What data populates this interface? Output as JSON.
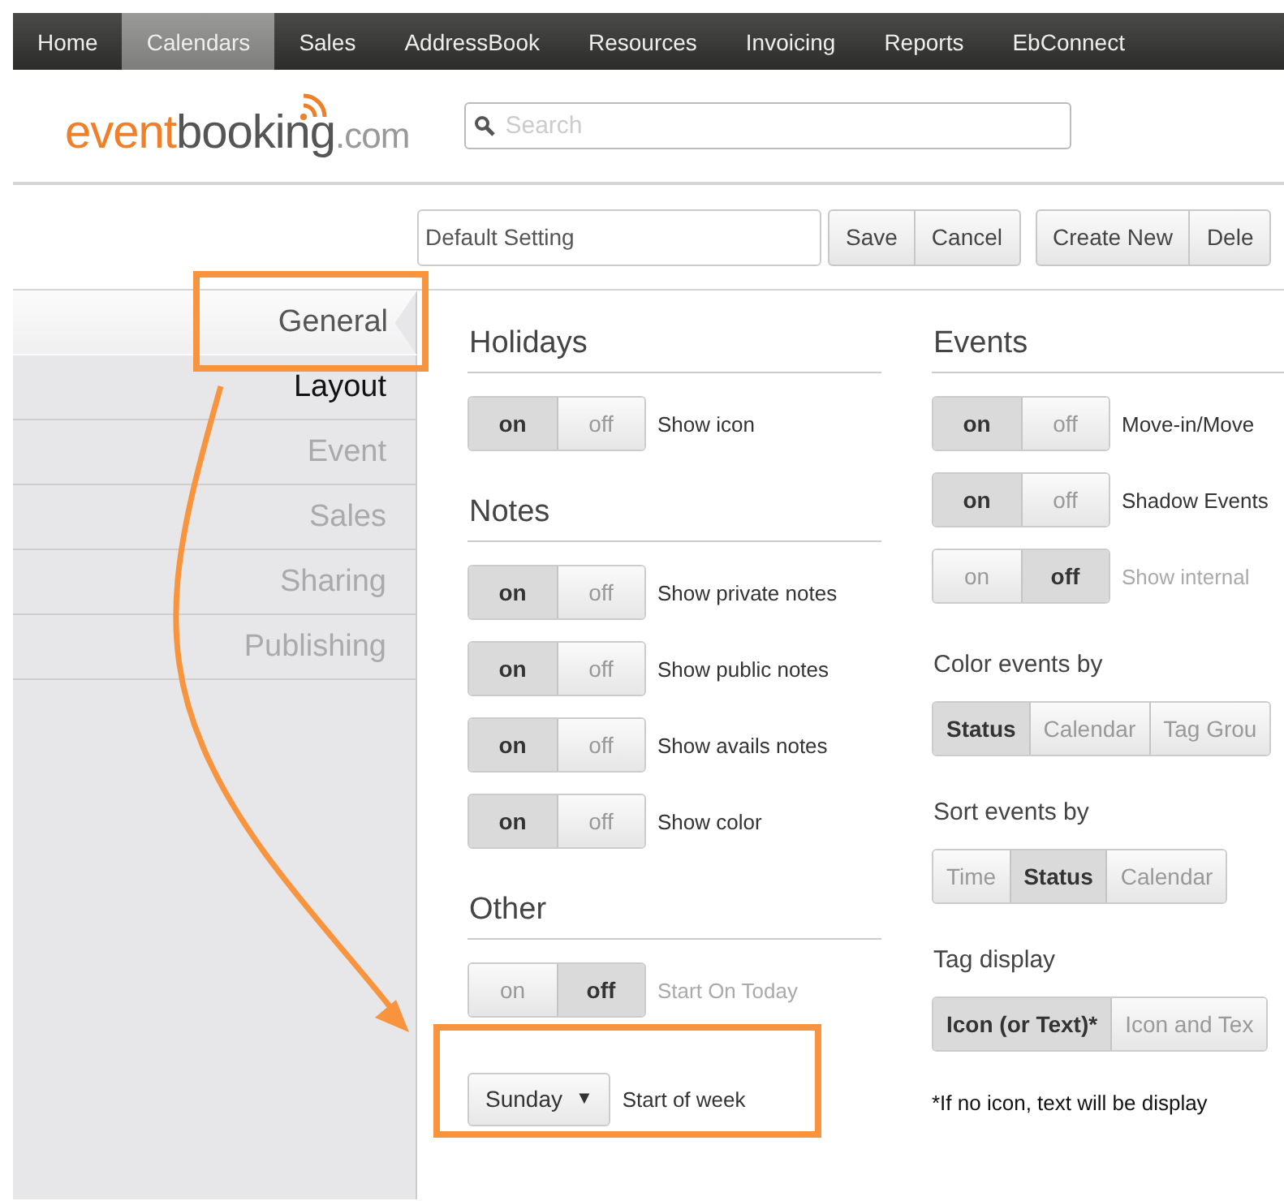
{
  "nav": {
    "items": [
      {
        "label": "Home",
        "selected": false
      },
      {
        "label": "Calendars",
        "selected": true
      },
      {
        "label": "Sales",
        "selected": false
      },
      {
        "label": "AddressBook",
        "selected": false
      },
      {
        "label": "Resources",
        "selected": false
      },
      {
        "label": "Invoicing",
        "selected": false
      },
      {
        "label": "Reports",
        "selected": false
      },
      {
        "label": "EbConnect",
        "selected": false
      }
    ]
  },
  "logo": {
    "parts": [
      "event",
      "booking",
      ".com"
    ]
  },
  "search": {
    "placeholder": "Search"
  },
  "toolbar": {
    "setting_name": "Default Setting",
    "group_1": [
      "Save",
      "Cancel"
    ],
    "group_2": [
      "Create New",
      "Dele"
    ]
  },
  "sidebar": {
    "items": [
      {
        "label": "General",
        "selected": true,
        "disabled": false
      },
      {
        "label": "Layout",
        "selected": false,
        "disabled": false
      },
      {
        "label": "Event",
        "selected": false,
        "disabled": true
      },
      {
        "label": "Sales",
        "selected": false,
        "disabled": true
      },
      {
        "label": "Sharing",
        "selected": false,
        "disabled": true
      },
      {
        "label": "Publishing",
        "selected": false,
        "disabled": true
      }
    ]
  },
  "settings_left": [
    {
      "kind": "heading",
      "text": "Holidays"
    },
    {
      "kind": "toggle",
      "on": true,
      "on_label": "on",
      "off_label": "off",
      "label": "Show icon"
    },
    {
      "kind": "heading",
      "text": "Notes"
    },
    {
      "kind": "toggle",
      "on": true,
      "on_label": "on",
      "off_label": "off",
      "label": "Show private notes"
    },
    {
      "kind": "toggle",
      "on": true,
      "on_label": "on",
      "off_label": "off",
      "label": "Show public notes"
    },
    {
      "kind": "toggle",
      "on": true,
      "on_label": "on",
      "off_label": "off",
      "label": "Show avails notes"
    },
    {
      "kind": "toggle",
      "on": true,
      "on_label": "on",
      "off_label": "off",
      "label": "Show color"
    },
    {
      "kind": "heading",
      "text": "Other"
    },
    {
      "kind": "toggle",
      "on": false,
      "on_label": "on",
      "off_label": "off",
      "label": "Start On Today"
    },
    {
      "kind": "select",
      "value": "Sunday",
      "caret": "▼",
      "label": "Start of week"
    }
  ],
  "settings_right": [
    {
      "kind": "heading",
      "text": "Events"
    },
    {
      "kind": "toggle",
      "on": true,
      "on_label": "on",
      "off_label": "off",
      "label": "Move-in/Move"
    },
    {
      "kind": "toggle",
      "on": true,
      "on_label": "on",
      "off_label": "off",
      "label": "Shadow Events"
    },
    {
      "kind": "toggle",
      "on": false,
      "on_label": "on",
      "off_label": "off",
      "label": "Show internal"
    },
    {
      "kind": "subheading",
      "text": "Color events by"
    },
    {
      "kind": "segmented",
      "options": [
        {
          "label": "Status",
          "selected": true
        },
        {
          "label": "Calendar",
          "selected": false
        },
        {
          "label": "Tag Grou",
          "selected": false
        }
      ]
    },
    {
      "kind": "subheading",
      "text": "Sort events by"
    },
    {
      "kind": "segmented",
      "options": [
        {
          "label": "Time",
          "selected": false
        },
        {
          "label": "Status",
          "selected": true
        },
        {
          "label": "Calendar",
          "selected": false
        }
      ]
    },
    {
      "kind": "subheading",
      "text": "Tag display"
    },
    {
      "kind": "segmented",
      "options": [
        {
          "label": "Icon (or Text)*",
          "selected": true
        },
        {
          "label": "Icon and Tex",
          "selected": false
        }
      ]
    },
    {
      "kind": "note",
      "text": "*If no icon, text will be display"
    }
  ]
}
